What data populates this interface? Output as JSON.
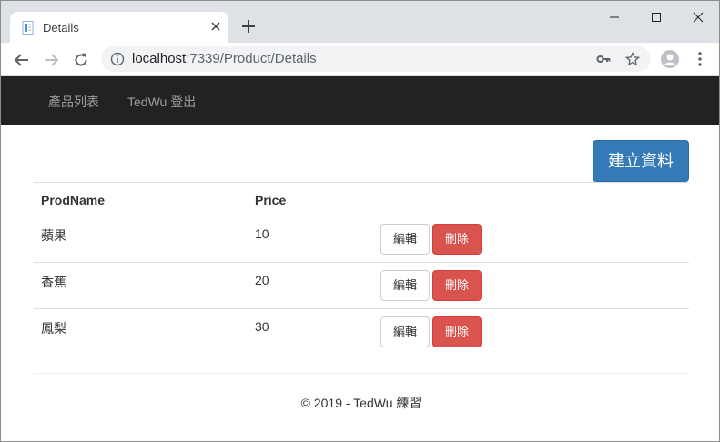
{
  "browser": {
    "tab_title": "Details",
    "url_host": "localhost",
    "url_rest": ":7339/Product/Details"
  },
  "navbar": {
    "items": [
      {
        "label": "產品列表"
      },
      {
        "label": "TedWu 登出"
      }
    ]
  },
  "page": {
    "create_label": "建立資料",
    "table": {
      "headers": [
        "ProdName",
        "Price"
      ],
      "rows": [
        {
          "name": "蘋果",
          "price": "10"
        },
        {
          "name": "香蕉",
          "price": "20"
        },
        {
          "name": "鳳梨",
          "price": "30"
        }
      ],
      "edit_label": "編輯",
      "delete_label": "刪除"
    },
    "footer": "© 2019 - TedWu 練習"
  },
  "colors": {
    "navbar": "#222222",
    "primary": "#337ab7",
    "danger": "#d9534f"
  }
}
